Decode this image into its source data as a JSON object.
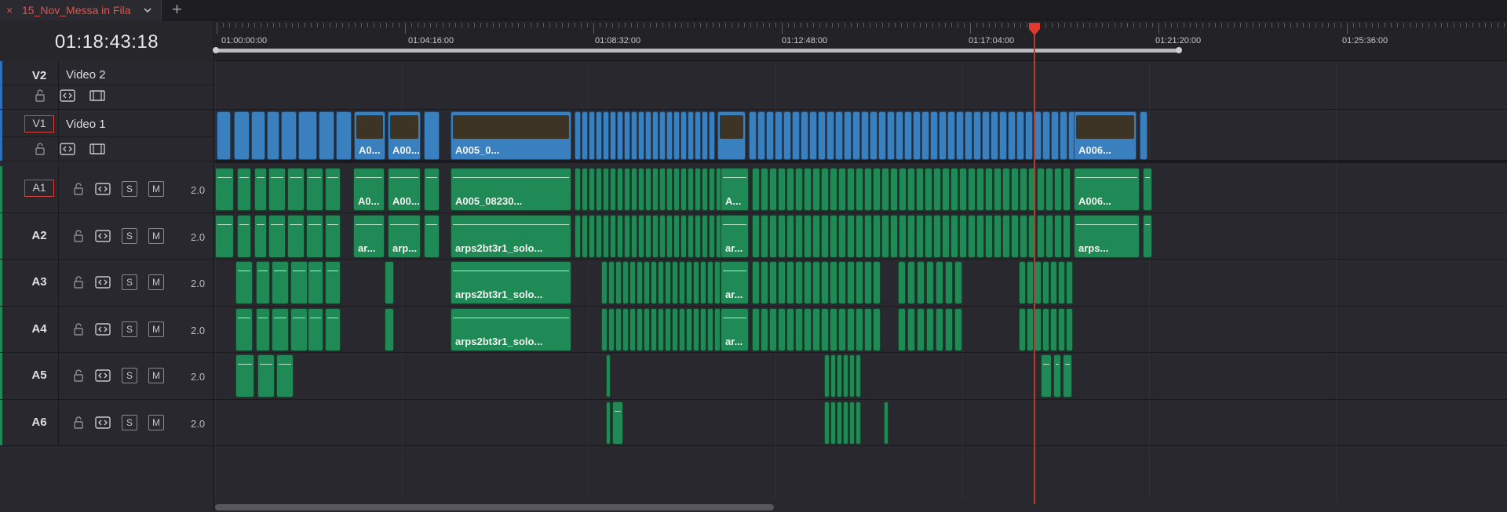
{
  "tab": {
    "title": "15_Nov_Messa in Fila",
    "close_glyph": "×",
    "add_glyph": "+"
  },
  "timecode": "01:18:43:18",
  "ruler": {
    "labels": [
      "01:00:00:00",
      "01:04:16:00",
      "01:08:32:00",
      "01:12:48:00",
      "01:17:04:00",
      "01:21:20:00",
      "01:25:36:00"
    ]
  },
  "tracks": {
    "video": [
      {
        "id": "V2",
        "name": "Video 2",
        "selected": false
      },
      {
        "id": "V1",
        "name": "Video 1",
        "selected": true
      }
    ],
    "audio": [
      {
        "id": "A1",
        "channels": "2.0",
        "solo_label": "S",
        "mute_label": "M",
        "selected": true
      },
      {
        "id": "A2",
        "channels": "2.0",
        "solo_label": "S",
        "mute_label": "M",
        "selected": false
      },
      {
        "id": "A3",
        "channels": "2.0",
        "solo_label": "S",
        "mute_label": "M",
        "selected": false
      },
      {
        "id": "A4",
        "channels": "2.0",
        "solo_label": "S",
        "mute_label": "M",
        "selected": false
      },
      {
        "id": "A5",
        "channels": "2.0",
        "solo_label": "S",
        "mute_label": "M",
        "selected": false
      },
      {
        "id": "A6",
        "channels": "2.0",
        "solo_label": "S",
        "mute_label": "M",
        "selected": false
      }
    ]
  },
  "clip_labels": {
    "v1": [
      "A0...",
      "A00...",
      "A005_0...",
      "A006..."
    ],
    "a1": [
      "A0...",
      "A00...",
      "A005_08230...",
      "A...",
      "A006..."
    ],
    "a2": [
      "ar...",
      "arp...",
      "arps2bt3r1_solo...",
      "ar...",
      "arps..."
    ],
    "a3": [
      "arps2bt3r1_solo...",
      "ar..."
    ],
    "a4": [
      "arps2bt3r1_solo...",
      "ar..."
    ]
  },
  "colors": {
    "video_clip": "#3a7fbe",
    "audio_clip": "#1f8a55",
    "playhead": "#e0392e",
    "accent_red": "#e4534b"
  }
}
